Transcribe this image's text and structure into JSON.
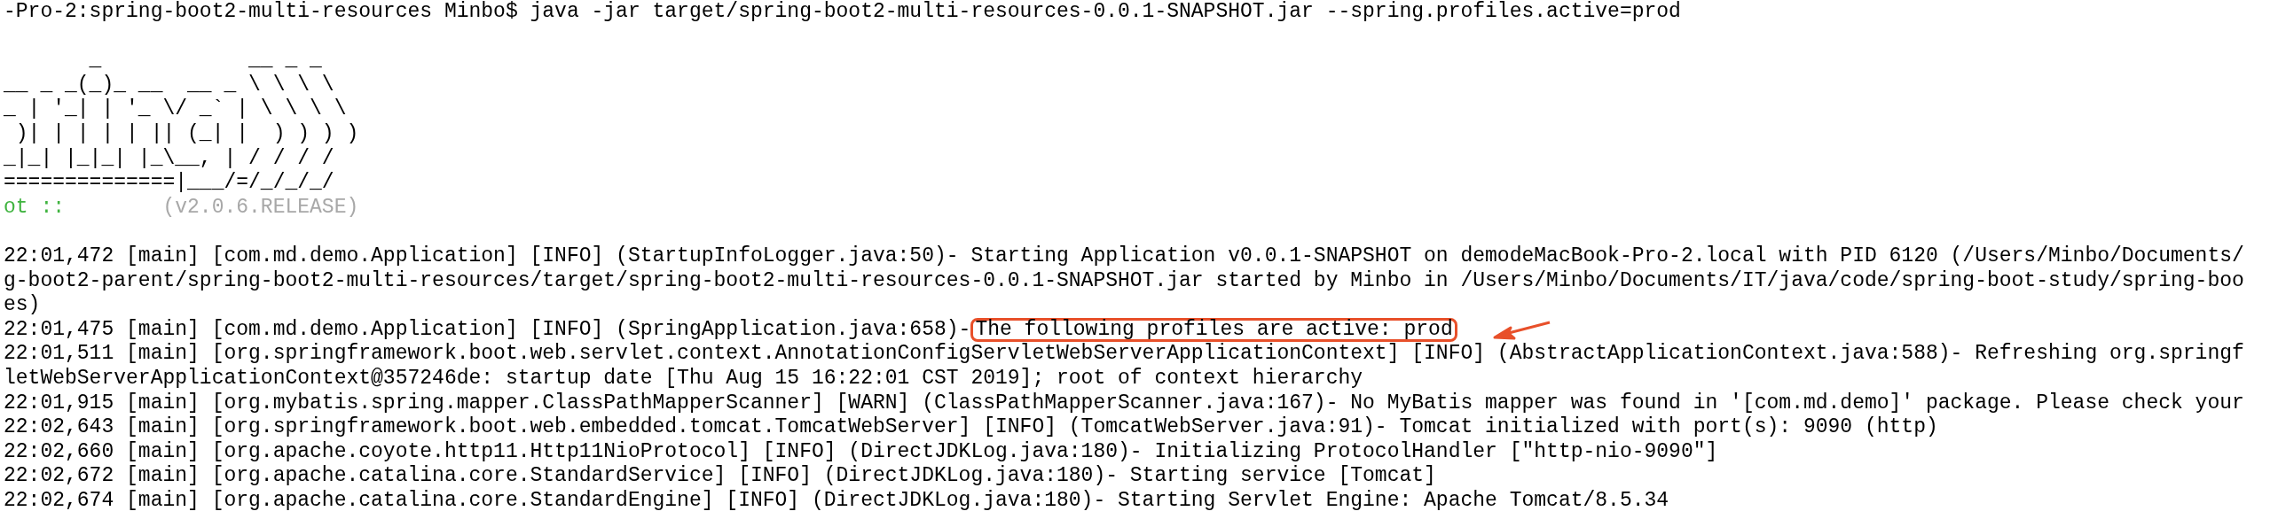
{
  "terminal": {
    "command": "-Pro-2:spring-boot2-multi-resources Minbo$ java -jar target/spring-boot2-multi-resources-0.0.1-SNAPSHOT.jar --spring.profiles.active=prod",
    "banner": [
      "       _            __ _ _",
      "__ _ _(_)_ __  __ _ \\ \\ \\ \\",
      "_ | '_| | '_ \\/ _` | \\ \\ \\ \\",
      " )| | | | | || (_| |  ) ) ) )",
      "_|_| |_|_| |_\\__, | / / / /",
      "==============|___/=/_/_/_/"
    ],
    "banner_footer": [
      {
        "kind": "label",
        "text": "ot ::"
      },
      {
        "kind": "version",
        "text": "        (v2.0.6.RELEASE)"
      }
    ],
    "log_lines": [
      {
        "text": "22:01,472 [main] [com.md.demo.Application] [INFO] (StartupInfoLogger.java:50)- Starting Application v0.0.1-SNAPSHOT on demodeMacBook-Pro-2.local with PID 6120 (/Users/Minbo/Documents/"
      },
      {
        "text": "g-boot2-parent/spring-boot2-multi-resources/target/spring-boot2-multi-resources-0.0.1-SNAPSHOT.jar started by Minbo in /Users/Minbo/Documents/IT/java/code/spring-boot-study/spring-boo"
      },
      {
        "text": "es)"
      },
      {
        "text": "22:01,475 [main] [com.md.demo.Application] [INFO] (SpringApplication.java:658)-",
        "highlight": "The following profiles are active: prod"
      },
      {
        "text": "22:01,511 [main] [org.springframework.boot.web.servlet.context.AnnotationConfigServletWebServerApplicationContext] [INFO] (AbstractApplicationContext.java:588)- Refreshing org.springf"
      },
      {
        "text": "letWebServerApplicationContext@357246de: startup date [Thu Aug 15 16:22:01 CST 2019]; root of context hierarchy"
      },
      {
        "text": "22:01,915 [main] [org.mybatis.spring.mapper.ClassPathMapperScanner] [WARN] (ClassPathMapperScanner.java:167)- No MyBatis mapper was found in '[com.md.demo]' package. Please check your"
      },
      {
        "text": "22:02,643 [main] [org.springframework.boot.web.embedded.tomcat.TomcatWebServer] [INFO] (TomcatWebServer.java:91)- Tomcat initialized with port(s): 9090 (http)"
      },
      {
        "text": "22:02,660 [main] [org.apache.coyote.http11.Http11NioProtocol] [INFO] (DirectJDKLog.java:180)- Initializing ProtocolHandler [\"http-nio-9090\"]"
      },
      {
        "text": "22:02,672 [main] [org.apache.catalina.core.StandardService] [INFO] (DirectJDKLog.java:180)- Starting service [Tomcat]"
      },
      {
        "text": "22:02,674 [main] [org.apache.catalina.core.StandardEngine] [INFO] (DirectJDKLog.java:180)- Starting Servlet Engine: Apache Tomcat/8.5.34"
      }
    ]
  }
}
